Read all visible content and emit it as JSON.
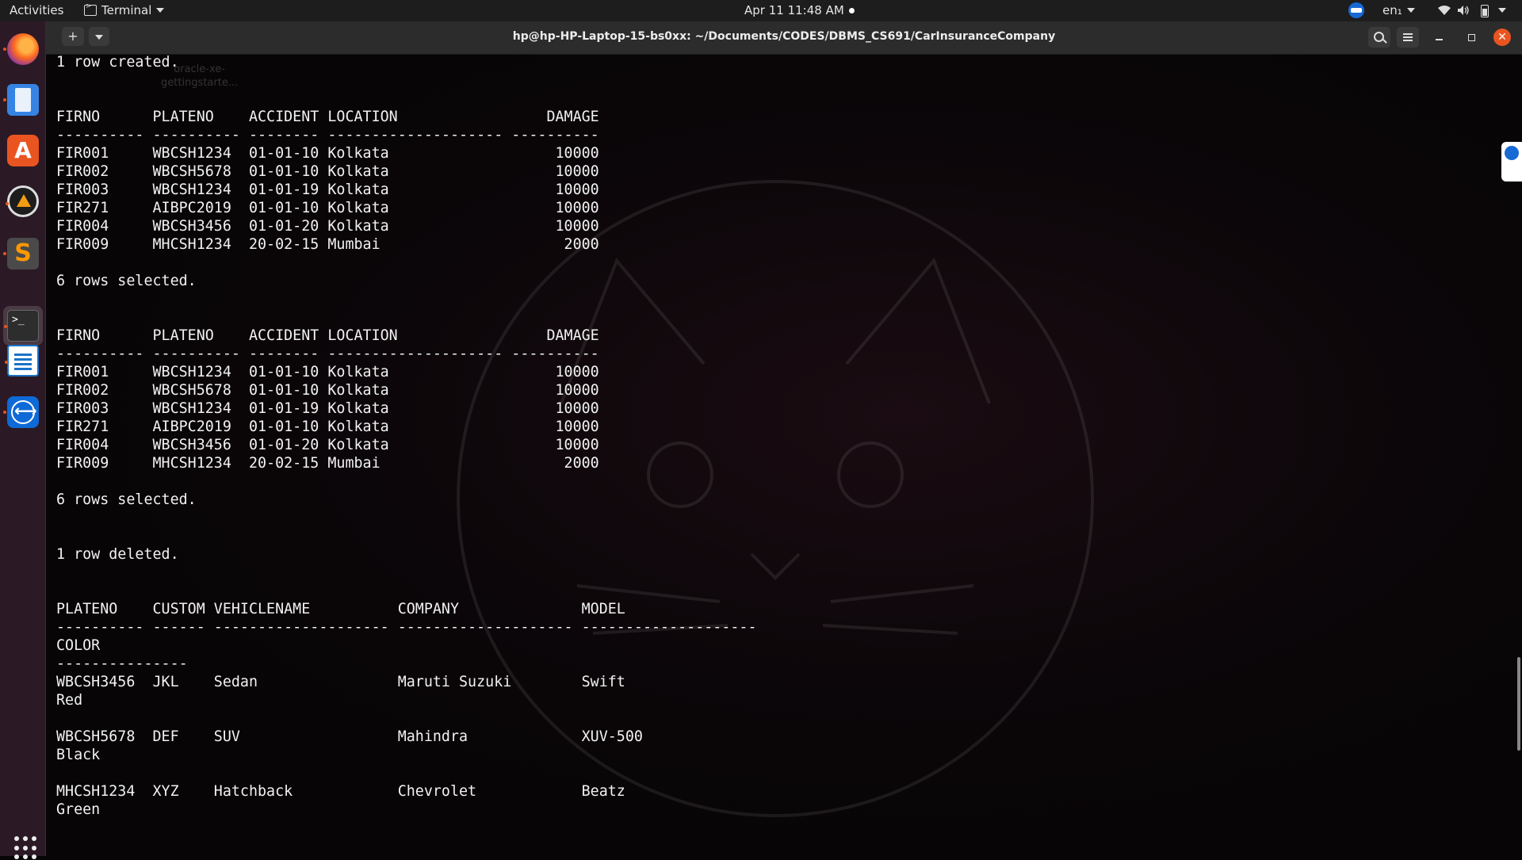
{
  "topbar": {
    "activities": "Activities",
    "app_name": "Terminal",
    "clock": "Apr 11  11:48 AM",
    "language": "en₁"
  },
  "dock": {
    "icons": [
      "firefox-icon",
      "files-icon",
      "software-store-icon",
      "drawio-icon",
      "sublime-text-icon",
      "terminal-icon",
      "writer-icon",
      "teamviewer-icon"
    ]
  },
  "window": {
    "title": "hp@hp-HP-Laptop-15-bs0xx: ~/Documents/CODES/DBMS_CS691/CarInsuranceCompany"
  },
  "desktop_ghost": {
    "label_line1": "oracle-xe-",
    "label_line2": "gettingstarte..."
  },
  "terminal": {
    "output": "1 row created.\n\n\nFIRNO      PLATENO    ACCIDENT LOCATION                 DAMAGE\n---------- ---------- -------- -------------------- ----------\nFIR001     WBCSH1234  01-01-10 Kolkata                   10000\nFIR002     WBCSH5678  01-01-10 Kolkata                   10000\nFIR003     WBCSH1234  01-01-19 Kolkata                   10000\nFIR271     AIBPC2019  01-01-10 Kolkata                   10000\nFIR004     WBCSH3456  01-01-20 Kolkata                   10000\nFIR009     MHCSH1234  20-02-15 Mumbai                     2000\n\n6 rows selected.\n\n\nFIRNO      PLATENO    ACCIDENT LOCATION                 DAMAGE\n---------- ---------- -------- -------------------- ----------\nFIR001     WBCSH1234  01-01-10 Kolkata                   10000\nFIR002     WBCSH5678  01-01-10 Kolkata                   10000\nFIR003     WBCSH1234  01-01-19 Kolkata                   10000\nFIR271     AIBPC2019  01-01-10 Kolkata                   10000\nFIR004     WBCSH3456  01-01-20 Kolkata                   10000\nFIR009     MHCSH1234  20-02-15 Mumbai                     2000\n\n6 rows selected.\n\n\n1 row deleted.\n\n\nPLATENO    CUSTOM VEHICLENAME          COMPANY              MODEL\n---------- ------ -------------------- -------------------- --------------------\nCOLOR\n---------------\nWBCSH3456  JKL    Sedan                Maruti Suzuki        Swift\nRed\n\nWBCSH5678  DEF    SUV                  Mahindra             XUV-500\nBlack\n\nMHCSH1234  XYZ    Hatchback            Chevrolet            Beatz\nGreen"
  },
  "colors": {
    "ubuntu_orange": "#e95420",
    "terminal_bg": "#070506",
    "terminal_text": "#f2f2f2",
    "dock_bg": "#2b1a25"
  }
}
